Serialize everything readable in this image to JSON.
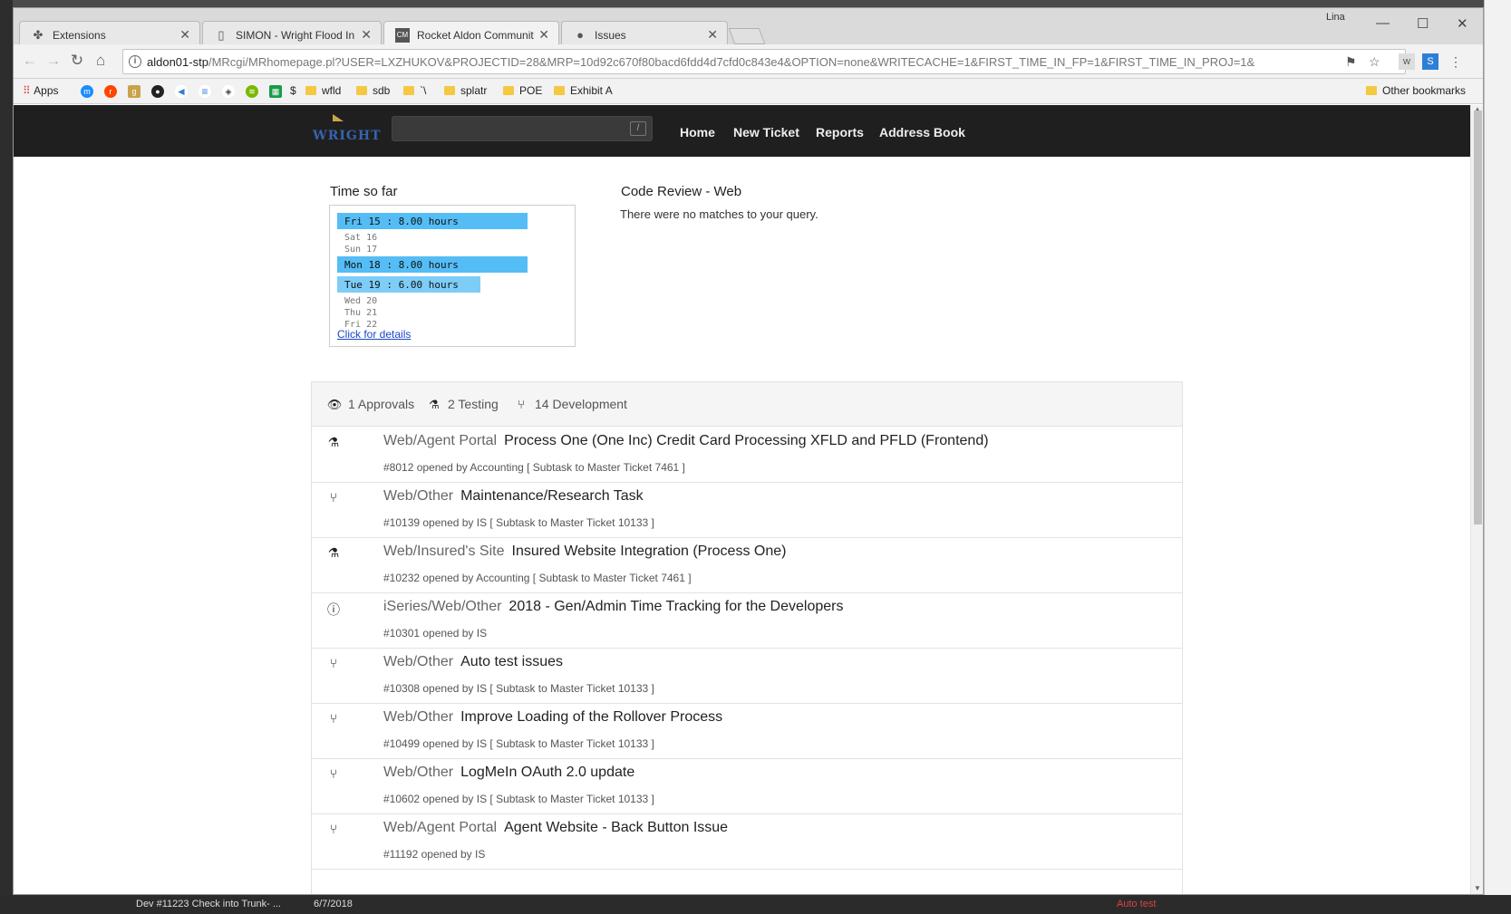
{
  "browser": {
    "tabs": [
      {
        "title": "Extensions",
        "icon": "puzzle-icon"
      },
      {
        "title": "SIMON - Wright Flood In",
        "icon": "document-icon"
      },
      {
        "title": "Rocket Aldon Communit",
        "icon": "cm-icon"
      },
      {
        "title": "Issues",
        "icon": "github-icon"
      }
    ],
    "user_badge": "Lina",
    "url_host": "aldon01-stp",
    "url_path": "/MRcgi/MRhomepage.pl?USER=LXZHUKOV&PROJECTID=28&MRP=10d92c670f80bacd6fdd4d7cfd0c843e4&OPTION=none&WRITECACHE=1&FIRST_TIME_IN_FP=1&FIRST_TIME_IN_PROJ=1&",
    "bookmarks": [
      "Apps",
      "$",
      "wfld",
      "sdb",
      "`\\",
      "splatr",
      "POE",
      "Exhibit A"
    ],
    "other_bookmarks": "Other bookmarks"
  },
  "topnav": {
    "logo_text": "WRIGHT",
    "search_hint": "/",
    "links": [
      "Home",
      "New Ticket",
      "Reports",
      "Address Book"
    ]
  },
  "time": {
    "title": "Time so far",
    "days": [
      {
        "label": "Fri 15 : 8.00 hours",
        "hours": 8.0
      },
      {
        "label": "Sat 16",
        "hours": 0
      },
      {
        "label": "Sun 17",
        "hours": 0
      },
      {
        "label": "Mon 18 : 8.00 hours",
        "hours": 8.0
      },
      {
        "label": "Tue 19 : 6.00 hours",
        "hours": 6.0
      },
      {
        "label": "Wed 20",
        "hours": 0
      },
      {
        "label": "Thu 21",
        "hours": 0
      },
      {
        "label": "Fri 22",
        "hours": 0
      }
    ],
    "details_link": "Click for details"
  },
  "code_review": {
    "title": "Code Review - Web",
    "message": "There were no matches to your query."
  },
  "summary": {
    "approvals": "1 Approvals",
    "testing": "2 Testing",
    "development": "14 Development"
  },
  "tickets": [
    {
      "icon": "flask-icon",
      "category": "Web/Agent Portal",
      "title": "Process One (One Inc) Credit Card Processing XFLD and PFLD (Frontend)",
      "meta": "#8012 opened by Accounting [ Subtask to Master Ticket 7461 ]"
    },
    {
      "icon": "branch-icon",
      "category": "Web/Other",
      "title": "Maintenance/Research Task",
      "meta": "#10139 opened by IS [ Subtask to Master Ticket 10133 ]"
    },
    {
      "icon": "flask-icon",
      "category": "Web/Insured's Site",
      "title": "Insured Website Integration (Process One)",
      "meta": "#10232 opened by Accounting [ Subtask to Master Ticket 7461 ]"
    },
    {
      "icon": "alert-icon",
      "category": "iSeries/Web/Other",
      "title": "2018 - Gen/Admin Time Tracking for the Developers",
      "meta": "#10301 opened by IS"
    },
    {
      "icon": "branch-icon",
      "category": "Web/Other",
      "title": "Auto test issues",
      "meta": "#10308 opened by IS [ Subtask to Master Ticket 10133 ]"
    },
    {
      "icon": "branch-icon",
      "category": "Web/Other",
      "title": "Improve Loading of the Rollover Process",
      "meta": "#10499 opened by IS [ Subtask to Master Ticket 10133 ]"
    },
    {
      "icon": "branch-icon",
      "category": "Web/Other",
      "title": "LogMeIn OAuth 2.0 update",
      "meta": "#10602 opened by IS [ Subtask to Master Ticket 10133 ]"
    },
    {
      "icon": "branch-icon",
      "category": "Web/Agent Portal",
      "title": "Agent Website - Back Button Issue",
      "meta": "#11192 opened by IS"
    }
  ],
  "desktop": {
    "taskbar_item": "Dev #11223 Check into Trunk- ...",
    "taskbar_date": "6/7/2018",
    "taskbar_status": "Auto test"
  }
}
